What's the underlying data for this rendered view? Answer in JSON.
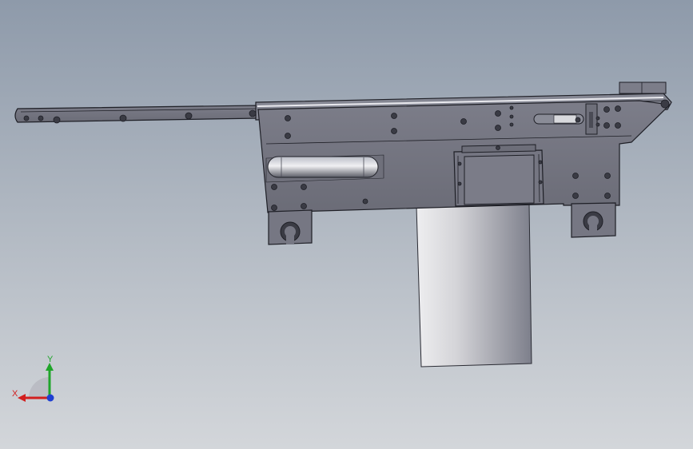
{
  "viewport": {
    "background_top": "#8e9aaa",
    "background_bottom": "#d3d6da"
  },
  "model": {
    "body_color": "#73747f",
    "edge_color": "#1e1f26",
    "cylinder_light": "#d9d9dc",
    "cylinder_dark": "#7d7f8b",
    "hole_color": "#3a3b44"
  },
  "triad": {
    "x_label": "X",
    "y_label": "Y",
    "x_color": "#d21f1f",
    "y_color": "#1fa52a",
    "z_color": "#1f3fd2"
  }
}
